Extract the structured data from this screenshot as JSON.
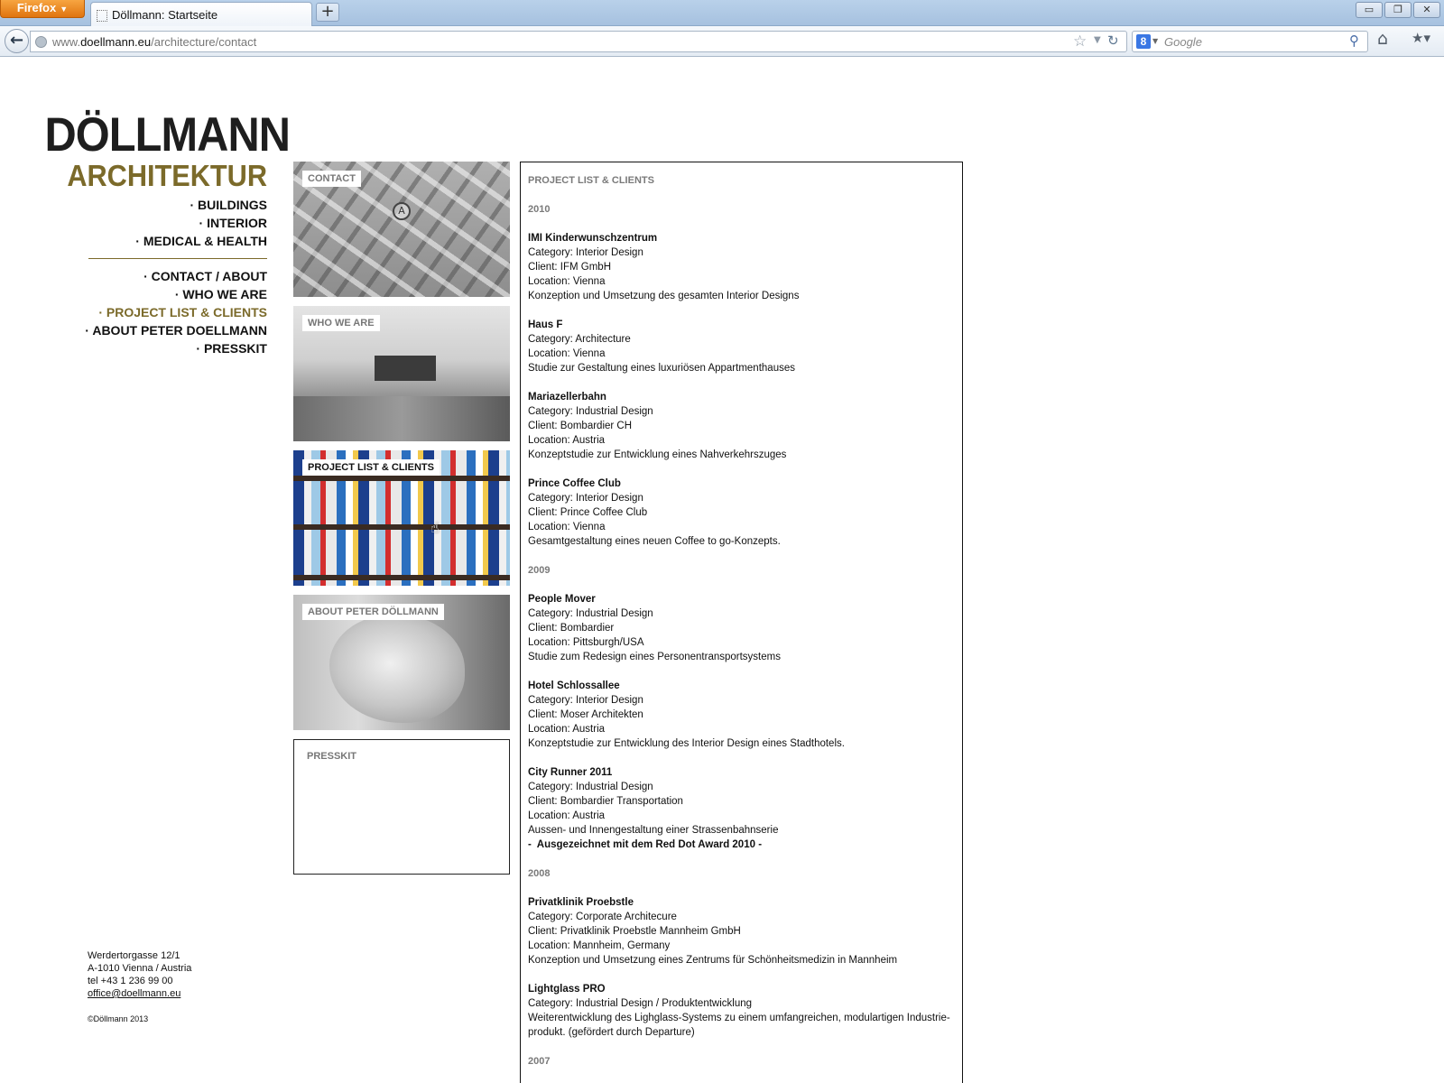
{
  "browser": {
    "app_button": "Firefox",
    "tab_title": "Döllmann: Startseite",
    "new_tab": "+",
    "url_prefix": "www.",
    "url_host": "doellmann.eu",
    "url_path": "/architecture/contact",
    "search_placeholder": "Google",
    "search_engine_label": "8",
    "window_buttons": [
      "▭",
      "❐",
      "✕"
    ]
  },
  "logo": {
    "main": "DÖLLMANN",
    "sub": "ARCHITEKTUR"
  },
  "menu_primary": [
    {
      "label": "· BUILDINGS"
    },
    {
      "label": "· INTERIOR"
    },
    {
      "label": "· MEDICAL & HEALTH"
    }
  ],
  "menu_secondary": [
    {
      "label": "· CONTACT / ABOUT"
    },
    {
      "label": "· WHO WE ARE"
    },
    {
      "label": "· PROJECT LIST & CLIENTS"
    },
    {
      "label": "· ABOUT PETER DOELLMANN"
    },
    {
      "label": "· PRESSKIT"
    }
  ],
  "active_color": "#7b6a2a",
  "address": {
    "street": "Werdertorgasse 12/1",
    "city": "A-1010 Vienna / Austria",
    "tel": "tel +43 1 236 99 00",
    "email": "office@doellmann.eu",
    "copyright": "©Döllmann 2013"
  },
  "tiles": {
    "contact": "CONTACT",
    "who": "WHO WE ARE",
    "projects": "PROJECT LIST & CLIENTS",
    "about": "ABOUT PETER DÖLLMANN",
    "press": "PRESSKIT",
    "map_marker": "A"
  },
  "content": {
    "heading": "PROJECT LIST & CLIENTS",
    "years": {
      "y2010": "2010",
      "y2009": "2009",
      "y2008": "2008",
      "y2007": "2007"
    },
    "p2010": [
      {
        "title": "IMI Kinderwunschzentrum",
        "lines": [
          "Category: Interior Design",
          "Client: IFM GmbH",
          "Location: Vienna",
          "Konzeption und Umsetzung des gesamten Interior Designs"
        ]
      },
      {
        "title": "Haus F",
        "lines": [
          "Category: Architecture",
          "Location: Vienna",
          "Studie zur Gestaltung eines luxuriösen Appartmenthauses"
        ]
      },
      {
        "title": "Mariazellerbahn",
        "lines": [
          "Category: Industrial Design",
          "Client: Bombardier CH",
          "Location: Austria",
          "Konzeptstudie zur Entwicklung eines Nahverkehrszuges"
        ]
      },
      {
        "title": "Prince Coffee Club",
        "lines": [
          "Category: Interior Design",
          "Client: Prince Coffee Club",
          "Location: Vienna",
          "Gesamtgestaltung eines neuen Coffee to go-Konzepts."
        ]
      }
    ],
    "p2009": [
      {
        "title": "People Mover",
        "lines": [
          "Category: Industrial Design",
          "Client: Bombardier",
          "Location: Pittsburgh/USA",
          "Studie zum Redesign eines Personentransportsystems"
        ]
      },
      {
        "title": "Hotel Schlossallee",
        "lines": [
          "Category: Interior Design",
          "Client: Moser Architekten",
          "Location: Austria",
          "Konzeptstudie zur Entwicklung des Interior Design eines Stadthotels."
        ]
      },
      {
        "title": "City Runner 2011",
        "lines": [
          "Category: Industrial Design",
          "Client: Bombardier Transportation",
          "Location: Austria",
          "Aussen- und Innengestaltung einer Strassenbahnserie"
        ],
        "award": "-  Ausgezeichnet mit dem Red Dot Award 2010 -"
      }
    ],
    "p2008": [
      {
        "title": "Privatklinik Proebstle",
        "lines": [
          "Category: Corporate Architecure",
          "Client: Privatklinik Proebstle Mannheim GmbH",
          "Location: Mannheim, Germany",
          "Konzeption und Umsetzung eines Zentrums für Schönheitsmedizin in Mannheim"
        ]
      },
      {
        "title": "Lightglass PRO",
        "lines": [
          "Category: Industrial Design / Produktentwicklung",
          "Weiterentwicklung des Lighglass-Systems zu einem umfangreichen, modulartigen Industrie-",
          "produkt. (gefördert durch Departure)"
        ]
      }
    ]
  }
}
